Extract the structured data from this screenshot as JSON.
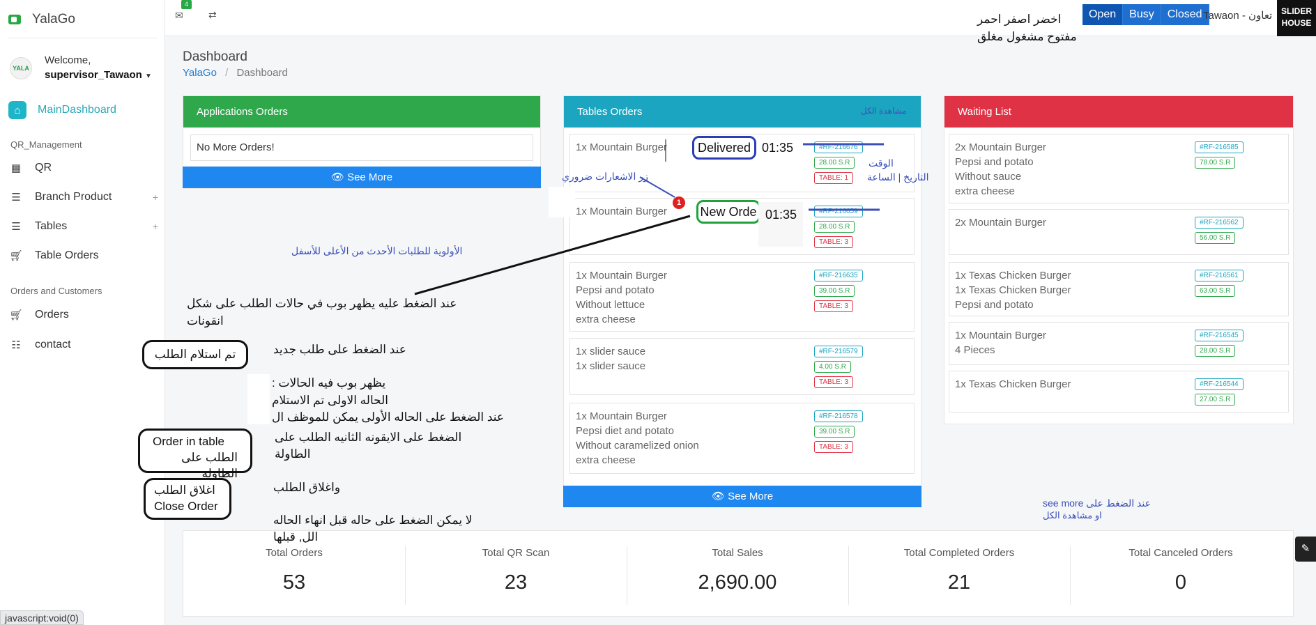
{
  "brand": {
    "name": "YalaGo"
  },
  "user": {
    "welcome": "Welcome,",
    "name": "supervisor_Tawaon",
    "avatar_text": "YALA"
  },
  "topbar": {
    "mail_count": "4",
    "annotation_colors": "اخضر اصفر احمر",
    "annotation_status": "مفتوح مشغول مغلق",
    "status_buttons": [
      "Open",
      "Busy",
      "Closed"
    ],
    "store_name": "Tawaon - تعاون",
    "store_logo": "SLIDER HOUSE"
  },
  "sidebar": {
    "main": "MainDashboard",
    "section_qr": "QR_Management",
    "items_qr": [
      "QR",
      "Branch Product",
      "Tables",
      "Table Orders"
    ],
    "section_orders": "Orders and Customers",
    "items_orders": [
      "Orders",
      "contact"
    ]
  },
  "page": {
    "title": "Dashboard",
    "crumb_home": "YalaGo",
    "crumb_current": "Dashboard"
  },
  "applications": {
    "title": "Applications Orders",
    "empty": "No More Orders!",
    "see_more": "See More"
  },
  "tables": {
    "title": "Tables Orders",
    "view_all": "مشاهدة الكل",
    "see_more": "See More",
    "orders": [
      {
        "lines": [
          "1x Mountain Burger"
        ],
        "ref": "#RF-216676",
        "price": "28.00 S.R",
        "table": "TABLE: 1"
      },
      {
        "lines": [
          "1x Mountain Burger"
        ],
        "ref": "#RF-216659",
        "price": "28.00 S.R",
        "table": "TABLE: 3"
      },
      {
        "lines": [
          "1x Mountain Burger",
          "Pepsi and potato",
          "Without lettuce",
          "extra cheese"
        ],
        "ref": "#RF-216635",
        "price": "39.00 S.R",
        "table": "TABLE: 3"
      },
      {
        "lines": [
          "1x slider sauce",
          "1x slider sauce"
        ],
        "ref": "#RF-216579",
        "price": "4.00 S.R",
        "table": "TABLE: 3"
      },
      {
        "lines": [
          "1x Mountain Burger",
          "Pepsi diet and potato",
          "Without caramelized onion",
          "extra cheese"
        ],
        "ref": "#RF-216578",
        "price": "39.00 S.R",
        "table": "TABLE: 3"
      }
    ]
  },
  "waiting": {
    "title": "Waiting List",
    "orders": [
      {
        "lines": [
          "2x Mountain Burger",
          "Pepsi and potato",
          "Without sauce",
          "extra cheese"
        ],
        "ref": "#RF-216585",
        "price": "78.00 S.R"
      },
      {
        "lines": [
          "2x Mountain Burger"
        ],
        "ref": "#RF-216562",
        "price": "56.00 S.R"
      },
      {
        "lines": [
          "1x Texas Chicken Burger",
          "1x Texas Chicken Burger",
          "Pepsi and potato"
        ],
        "ref": "#RF-216561",
        "price": "63.00 S.R"
      },
      {
        "lines": [
          "1x Mountain Burger",
          "4 Pieces"
        ],
        "ref": "#RF-216545",
        "price": "28.00 S.R"
      },
      {
        "lines": [
          "1x Texas Chicken Burger"
        ],
        "ref": "#RF-216544",
        "price": "27.00 S.R"
      }
    ]
  },
  "stats": [
    {
      "label": "Total Orders",
      "value": "53"
    },
    {
      "label": "Total QR Scan",
      "value": "23"
    },
    {
      "label": "Total Sales",
      "value": "2,690.00"
    },
    {
      "label": "Total Completed Orders",
      "value": "21"
    },
    {
      "label": "Total Canceled Orders",
      "value": "0"
    }
  ],
  "annotations": {
    "delivered": "Delivered",
    "time1": "01:35",
    "new_order": "New Orde",
    "time2": "01:35",
    "notif_count": "1",
    "notif_label": "زر الاشعارات ضروري",
    "time_label": "الوقت",
    "date_label": "التاريخ | الساعة",
    "priority": "الأولوية للطلبات الأحدث من الأعلى للأسفل",
    "popup_line1": "عند الضغط عليه يظهر بوب في حالات الطلب على شكل",
    "popup_line2": "انقونات",
    "received_btn": "تم استلام الطلب",
    "new_order_click": "عند الضغط على طلب جديد",
    "states_1": "يظهر بوب فيه الحالات :",
    "states_2": "الحاله الاولى تم الاستلام",
    "states_3": "عند الضغط على الحاله الأولى يمكن للموظف ال",
    "table_btn_1": "Order in table",
    "table_btn_2": "الطلب على الطاولة",
    "second_icon_1": "الضغط على الايقونه الثانيه الطلب على",
    "second_icon_2": "الطاولة",
    "close_btn_1": "اغلاق الطلب",
    "close_btn_2": "Close Order",
    "close_text": "واغلاق الطلب",
    "rule_1": "لا يمكن الضغط على حاله قبل انهاء الحاله",
    "rule_2": "الل, قبلها",
    "see_more_note_1": "عند الضغط على see more",
    "see_more_note_2": "او مشاهدة الكل"
  },
  "status_bar": "javascript:void(0)",
  "colors": {
    "green": "#2ea84a",
    "teal": "#1ba5c0",
    "red": "#e03245",
    "blue": "#1e87f0"
  }
}
